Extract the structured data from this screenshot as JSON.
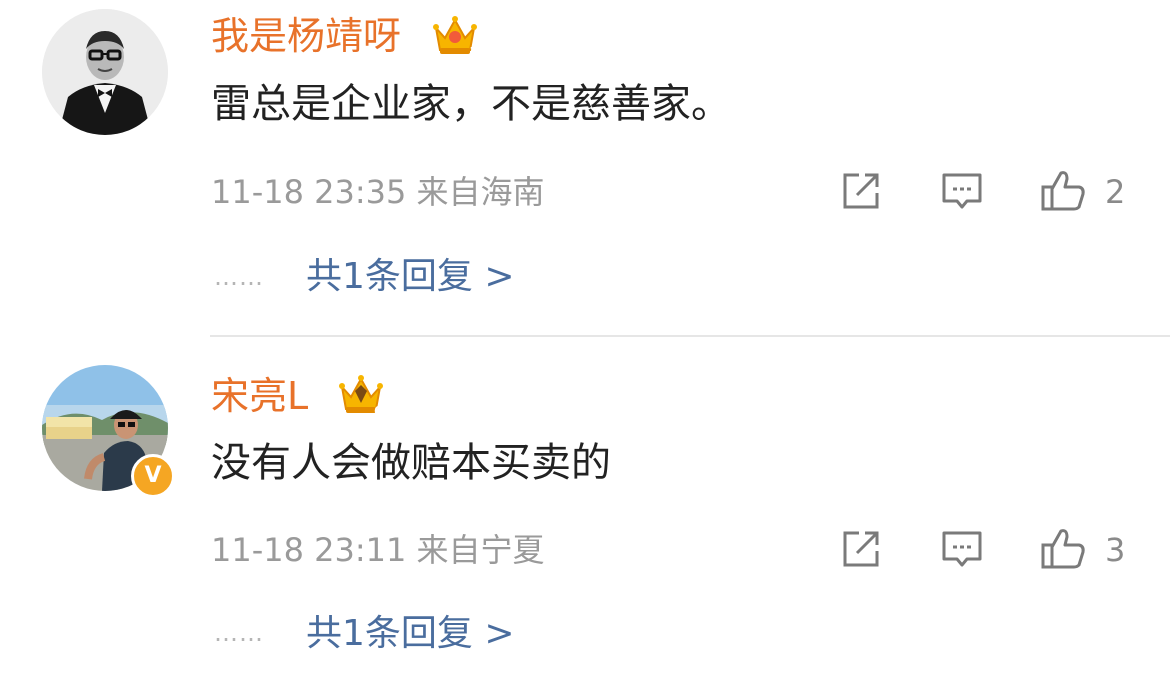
{
  "comments": [
    {
      "username": "我是杨靖呀",
      "text": "雷总是企业家，不是慈善家。",
      "meta": "11-18 23:35 来自海南",
      "likes": "2",
      "dots": "……",
      "reply_link": "共1条回复 >",
      "crown_level": "7",
      "avatar_icon": "avatar-man-bowtie",
      "verified": false
    },
    {
      "username": "宋亮L",
      "text": "没有人会做赔本买卖的",
      "meta": "11-18 23:11 来自宁夏",
      "likes": "3",
      "dots": "……",
      "reply_link": "共1条回复 >",
      "crown_level": "6",
      "avatar_icon": "avatar-man-cap-outdoor",
      "verified": true,
      "verified_badge": "V"
    }
  ],
  "colors": {
    "username": "#e8722a",
    "link": "#4a6d9e",
    "meta": "#9a9a9a",
    "verified": "#f5a623"
  },
  "icons": [
    "share-icon",
    "comment-icon",
    "like-icon",
    "crown-icon",
    "verified-icon"
  ]
}
